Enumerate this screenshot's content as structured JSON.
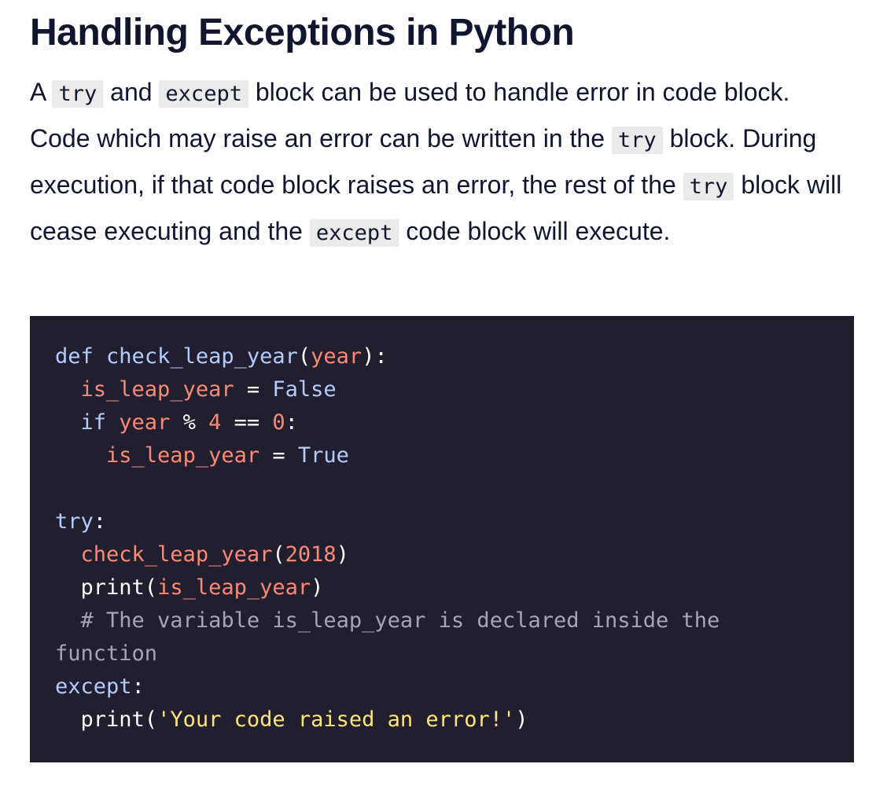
{
  "heading": "Handling Exceptions in Python",
  "paragraph": {
    "t0": "A ",
    "c1": "try",
    "t1": " and ",
    "c2": "except",
    "t2": " block can be used to handle error in code block. Code which may raise an error can be written in the ",
    "c3": "try",
    "t3": " block. During execution, if that code block raises an error, the rest of the ",
    "c4": "try",
    "t4": " block will cease executing and the ",
    "c5": "except",
    "t5": " code block will execute."
  },
  "code": {
    "l1_kw": "def",
    "l1_fn": "check_leap_year",
    "l1_p1": "(",
    "l1_arg": "year",
    "l1_p2": "):",
    "l2_var": "is_leap_year",
    "l2_op": " = ",
    "l2_val": "False",
    "l3_kw": "if",
    "l3_var": "year",
    "l3_op1": " % ",
    "l3_n1": "4",
    "l3_op2": " == ",
    "l3_n2": "0",
    "l3_end": ":",
    "l4_var": "is_leap_year",
    "l4_op": " = ",
    "l4_val": "True",
    "l6_kw": "try",
    "l6_end": ":",
    "l7_fn": "check_leap_year",
    "l7_p1": "(",
    "l7_num": "2018",
    "l7_p2": ")",
    "l8_fn": "print",
    "l8_p1": "(",
    "l8_var": "is_leap_year",
    "l8_p2": ")",
    "l9_comment": "# The variable is_leap_year is declared inside the",
    "l10_comment": "function",
    "l11_kw": "except",
    "l11_end": ":",
    "l12_fn": "print",
    "l12_p1": "(",
    "l12_str": "'Your code raised an error!'",
    "l12_p2": ")"
  },
  "colors": {
    "background": "#ffffff",
    "text": "#10162f",
    "inline_code_bg": "#eaeaea",
    "code_bg": "#211f2f",
    "keyword": "#b3ccff",
    "variable": "#ff8973",
    "string": "#ffe57a",
    "comment": "#a5a5b5"
  }
}
